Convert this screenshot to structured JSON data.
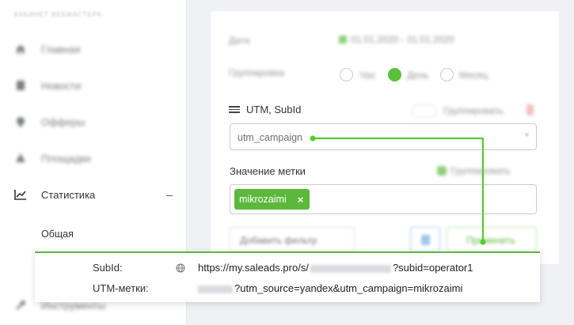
{
  "sidebar": {
    "header": "Кабинет вебмастера",
    "items": [
      {
        "label": "Главная",
        "icon": "home-icon"
      },
      {
        "label": "Новости",
        "icon": "news-icon"
      },
      {
        "label": "Офферы",
        "icon": "offers-icon"
      },
      {
        "label": "Площадки",
        "icon": "platforms-icon"
      },
      {
        "label": "Статистика",
        "icon": "chart-icon",
        "toggle": "–"
      },
      {
        "label": "Инструменты",
        "icon": "tools-icon"
      }
    ],
    "sub_items": [
      {
        "label": "Общая"
      }
    ]
  },
  "filters": {
    "date_label": "Дата",
    "date_value": "01.01.2020 - 31.01.2020",
    "group_label": "Группировка",
    "group_options": [
      {
        "label": "Час",
        "selected": false
      },
      {
        "label": "День",
        "selected": true
      },
      {
        "label": "Месяц",
        "selected": false
      }
    ],
    "utm_title": "UTM, SubId",
    "utm_toggle_label": "Группировать",
    "utm_select_value": "utm_campaign",
    "meta_label": "Значение метки",
    "meta_group_label": "Группировать",
    "tags": [
      {
        "label": "mikrozaimi"
      }
    ],
    "tag_remove": "×",
    "add_filter_label": "Добавить фильтр",
    "apply_label": "Применить"
  },
  "overlay": {
    "subid_label": "SubId:",
    "subid_url_prefix": "https://my.saleads.pro/s/",
    "subid_url_suffix": "?subid=operator1",
    "utm_label": "UTM-метки:",
    "utm_url_suffix": "?utm_source=yandex&utm_campaign=mikrozaimi"
  },
  "colors": {
    "accent": "#5cb83c",
    "background": "#f0f1f4"
  }
}
